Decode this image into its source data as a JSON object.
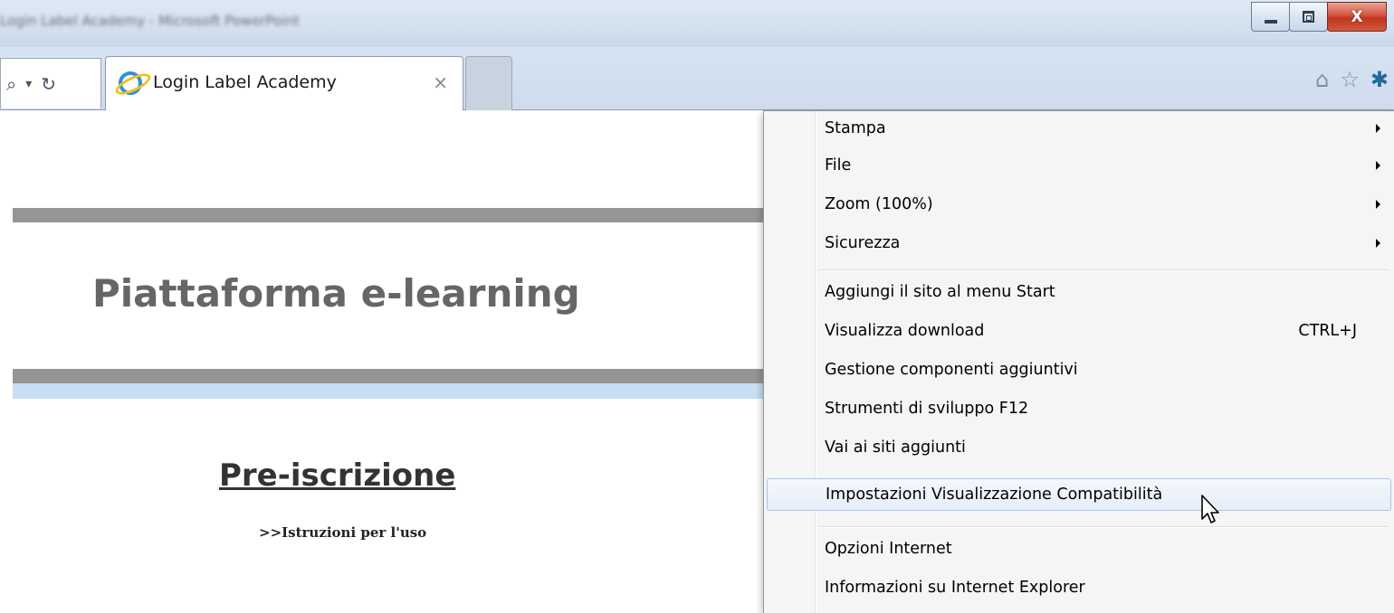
{
  "window": {
    "title": "Login Label Academy - Microsoft PowerPoint",
    "minimize_label": "",
    "maximize_label": "",
    "close_label": "X"
  },
  "browser": {
    "search_glyph": "⌕",
    "dropdown_glyph": "▾",
    "refresh_glyph": "↻",
    "tab": {
      "title": "Login Label Academy",
      "close_glyph": "×"
    },
    "toolbar": {
      "home_glyph": "⌂",
      "favorites_glyph": "☆",
      "tools_glyph": "✱"
    }
  },
  "page": {
    "title": "Piattaforma e-learning",
    "subtitle": "Pre-iscrizione",
    "link": ">>Istruzioni per l'uso"
  },
  "menu": {
    "group1": [
      {
        "label": "Stampa",
        "submenu": true
      },
      {
        "label": "File",
        "submenu": true
      },
      {
        "label": "Zoom (100%)",
        "submenu": true
      },
      {
        "label": "Sicurezza",
        "submenu": true
      }
    ],
    "group2": [
      {
        "label": "Aggiungi il sito al menu Start",
        "shortcut": ""
      },
      {
        "label": "Visualizza download",
        "shortcut": "CTRL+J"
      },
      {
        "label": "Gestione componenti aggiuntivi",
        "shortcut": ""
      },
      {
        "label": "Strumenti di sviluppo F12",
        "shortcut": ""
      },
      {
        "label": "Vai ai siti aggiunti",
        "shortcut": ""
      },
      {
        "label": "Impostazioni Visualizzazione Compatibilità",
        "shortcut": "",
        "highlighted": true
      }
    ],
    "group3": [
      {
        "label": "Opzioni Internet"
      },
      {
        "label": "Informazioni su Internet Explorer"
      }
    ]
  },
  "colors": {
    "title_bar": "#d3e0ef",
    "close_button": "#c2341c",
    "page_bar": "#959595",
    "page_bar_blue": "#c7def4",
    "menu_background": "#f5f5f5",
    "menu_highlight_border": "#a9c4e8"
  }
}
